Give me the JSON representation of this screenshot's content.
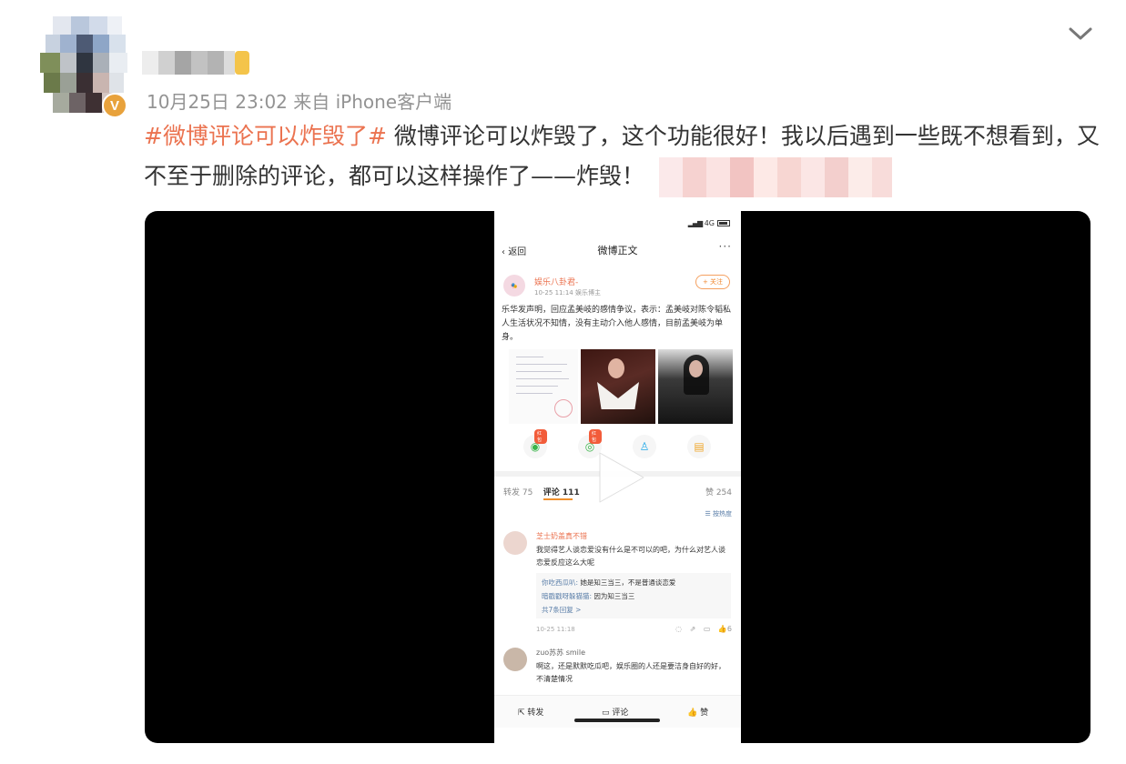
{
  "post": {
    "meta": "10月25日 23:02  来自 iPhone客户端",
    "hashtag": "#微博评论可以炸毁了#",
    "body": " 微博评论可以炸毁了，这个功能很好！我以后遇到一些既不想看到，又不至于删除的评论，都可以这样操作了——炸毁！"
  },
  "video": {
    "status_bar": "4G",
    "nav_back": "返回",
    "nav_title": "微博正文",
    "nav_more": "···",
    "inner_post": {
      "author": "娱乐八卦君-",
      "time": "10-25 11:14  娱乐博主",
      "follow": "+ 关注",
      "text": "乐华发声明，回应孟美岐的感情争议，表示：孟美岐对陈令韬私人生活状况不知情，没有主动介入他人感情，目前孟美岐为单身。"
    },
    "tabs": {
      "repost": "转发 75",
      "comments": "评论 111",
      "likes": "赞 254",
      "sort": "按热度"
    },
    "comments": [
      {
        "name": "芝士奶盖真不错",
        "text": "我觉得艺人谈恋爱没有什么是不可以的吧，为什么对艺人谈恋爱反应这么大呢",
        "replies": [
          {
            "name": "你吃西瓜叭:",
            "text": " 她是知三当三，不是普通谈恋爱"
          },
          {
            "name": "暗戳戳呀躲猫猫:",
            "text": " 因为知三当三"
          }
        ],
        "more_replies": "共7条回复 >",
        "time": "10-25 11:18",
        "likes": "6"
      },
      {
        "name": "zuo苏苏 smile",
        "text": "啊这，还是默默吃瓜吧，娱乐圈的人还是要洁身自好的好，不清楚情况"
      }
    ],
    "bottom_bar": {
      "repost": "转发",
      "comment": "评论",
      "like": "赞"
    },
    "badge_label": "红包"
  }
}
